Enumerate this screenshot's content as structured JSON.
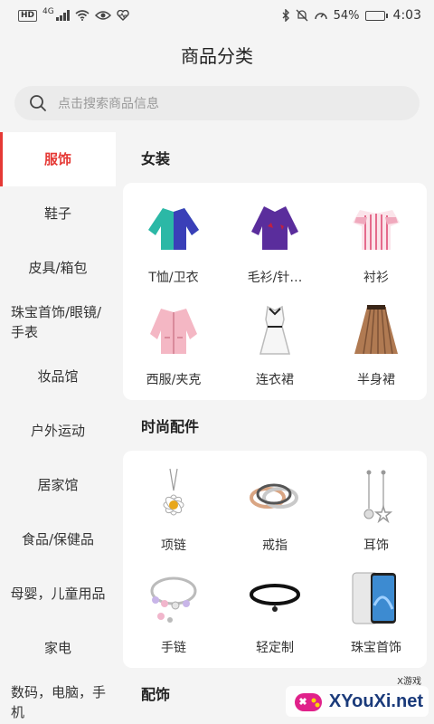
{
  "status_bar": {
    "hd": "HD",
    "net": "4G",
    "battery": "54%",
    "battery_level": 0.54,
    "time": "4:03"
  },
  "header": {
    "title": "商品分类"
  },
  "search": {
    "placeholder": "点击搜索商品信息"
  },
  "sidebar": {
    "items": [
      {
        "label": "服饰",
        "active": true
      },
      {
        "label": "鞋子"
      },
      {
        "label": "皮具/箱包"
      },
      {
        "label": "珠宝首饰/眼镜/手表"
      },
      {
        "label": "妆品馆"
      },
      {
        "label": "户外运动"
      },
      {
        "label": "居家馆"
      },
      {
        "label": "食品/保健品"
      },
      {
        "label": "母婴，儿童用品"
      },
      {
        "label": "家电"
      },
      {
        "label": "数码，电脑，手机"
      }
    ]
  },
  "sections": [
    {
      "title": "女装",
      "items": [
        {
          "label": "T恤/卫衣",
          "icon": "sweatshirt-icon"
        },
        {
          "label": "毛衫/针…",
          "icon": "sweater-icon"
        },
        {
          "label": "衬衫",
          "icon": "shirt-icon"
        },
        {
          "label": "西服/夹克",
          "icon": "jacket-icon"
        },
        {
          "label": "连衣裙",
          "icon": "dress-icon"
        },
        {
          "label": "半身裙",
          "icon": "skirt-icon"
        }
      ]
    },
    {
      "title": "时尚配件",
      "items": [
        {
          "label": "项链",
          "icon": "necklace-icon"
        },
        {
          "label": "戒指",
          "icon": "ring-icon"
        },
        {
          "label": "耳饰",
          "icon": "earring-icon"
        },
        {
          "label": "手链",
          "icon": "bracelet-icon"
        },
        {
          "label": "轻定制",
          "icon": "choker-icon"
        },
        {
          "label": "珠宝首饰",
          "icon": "phone-icon"
        }
      ]
    },
    {
      "title": "配饰"
    }
  ],
  "watermark": {
    "text": "XYouXi.net",
    "small": "X游戏"
  },
  "colors": {
    "accent": "#e53935",
    "background": "#f4f4f4",
    "card": "#ffffff"
  }
}
